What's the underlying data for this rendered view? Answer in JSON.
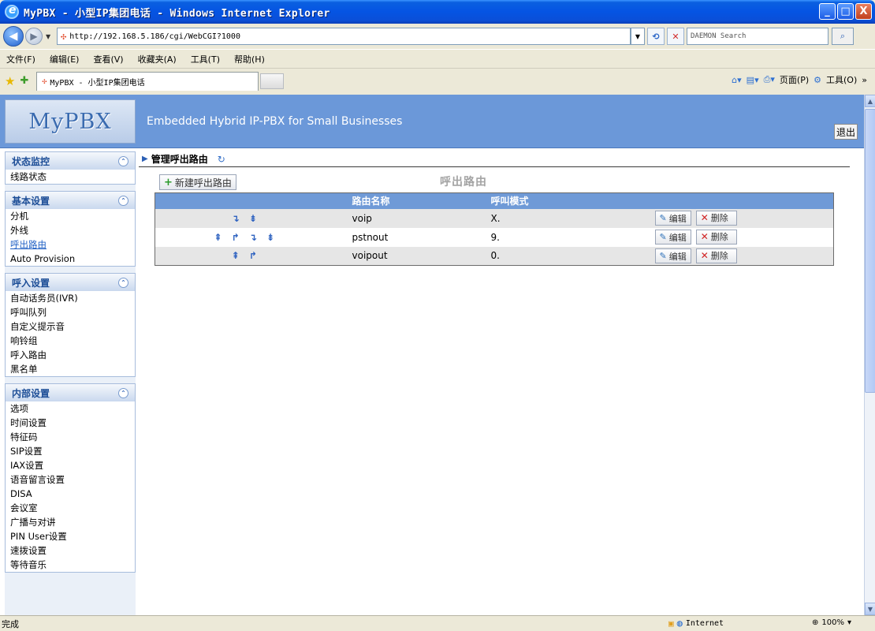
{
  "window": {
    "title": "MyPBX - 小型IP集团电话 - Windows Internet Explorer",
    "controls": {
      "minimize": "_",
      "maximize": "□",
      "close": "X"
    }
  },
  "address_bar": {
    "url": "http://192.168.5.186/cgi/WebCGI?1000",
    "search_placeholder": "DAEMON Search"
  },
  "menu": [
    "文件(F)",
    "编辑(E)",
    "查看(V)",
    "收藏夹(A)",
    "工具(T)",
    "帮助(H)"
  ],
  "tab": {
    "label": "MyPBX - 小型IP集团电话"
  },
  "command_bar": {
    "page_label": "页面(P)",
    "tools_label": "工具(O)"
  },
  "header": {
    "logo": "MyPBX",
    "tagline": "Embedded Hybrid IP-PBX for Small Businesses",
    "logout": "退出"
  },
  "sidebar": {
    "groups": [
      {
        "title": "状态监控",
        "items": [
          "线路状态"
        ]
      },
      {
        "title": "基本设置",
        "items": [
          "分机",
          "外线",
          "呼出路由",
          "Auto Provision"
        ]
      },
      {
        "title": "呼入设置",
        "items": [
          "自动话务员(IVR)",
          "呼叫队列",
          "自定义提示音",
          "响铃组",
          "呼入路由",
          "黑名单"
        ]
      },
      {
        "title": "内部设置",
        "items": [
          "选项",
          "时间设置",
          "特征码",
          "SIP设置",
          "IAX设置",
          "语音留言设置",
          "DISA",
          "会议室",
          "广播与对讲",
          "PIN User设置",
          "速拨设置",
          "等待音乐"
        ]
      }
    ],
    "active_item": "呼出路由"
  },
  "main": {
    "breadcrumb": "管理呼出路由",
    "new_button": "新建呼出路由",
    "section_title": "呼出路由",
    "table": {
      "headers": [
        "",
        "路由名称",
        "呼叫模式",
        ""
      ],
      "rows": [
        {
          "arrows": "↴ ⇟",
          "name": "voip",
          "mode": "X.",
          "edit": "编辑",
          "delete": "删除"
        },
        {
          "arrows": "⇞ ↱ ↴ ⇟",
          "name": "pstnout",
          "mode": "9.",
          "edit": "编辑",
          "delete": "删除"
        },
        {
          "arrows": "⇞ ↱",
          "name": "voipout",
          "mode": "0.",
          "edit": "编辑",
          "delete": "删除"
        }
      ]
    }
  },
  "status_bar": {
    "text": "完成",
    "zone": "Internet",
    "zoom": "100%"
  }
}
